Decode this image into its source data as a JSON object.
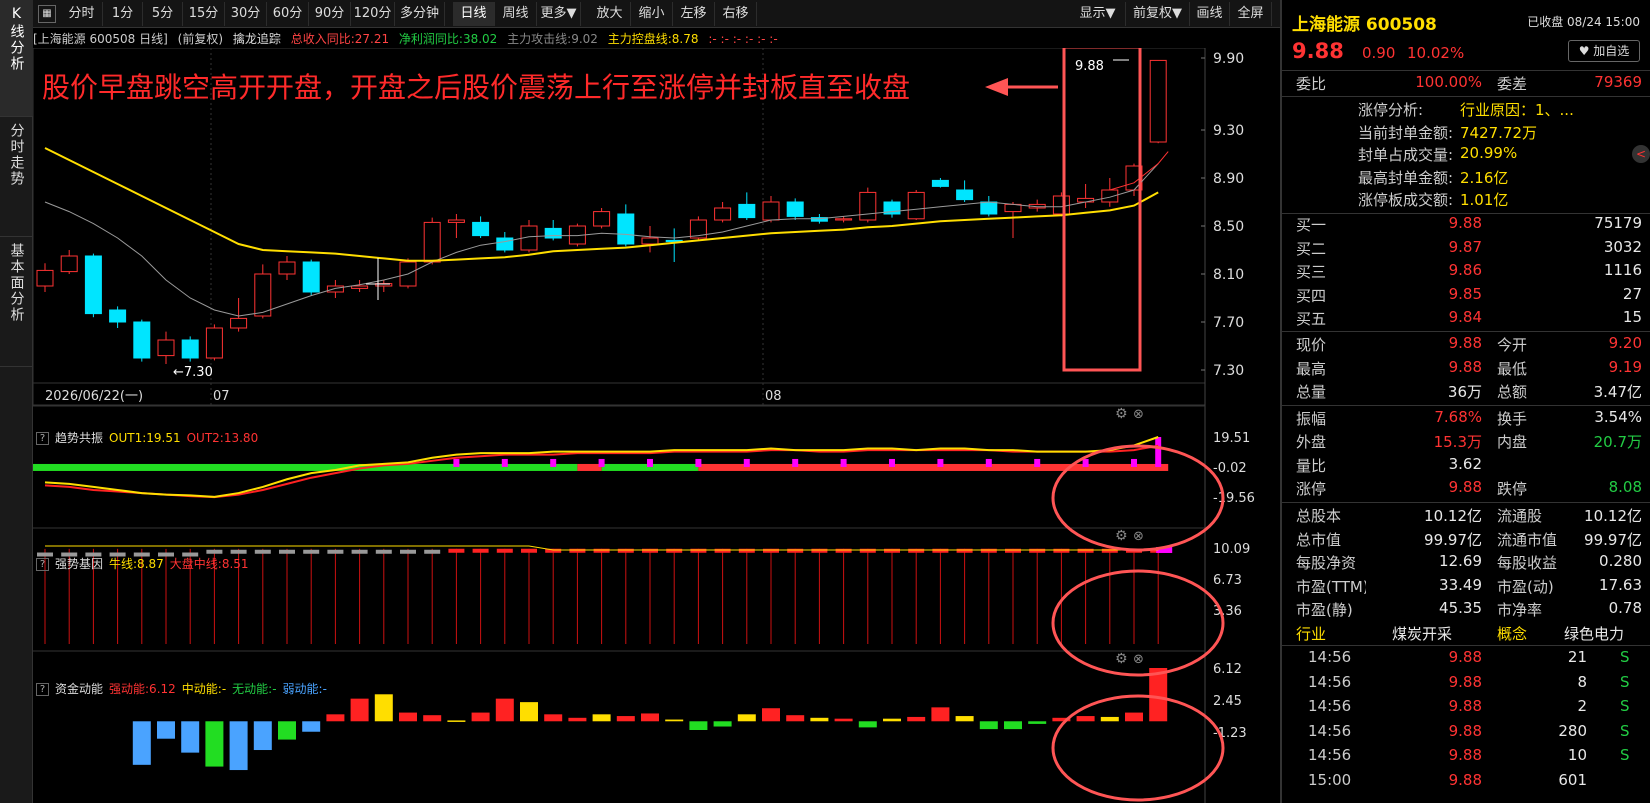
{
  "left_nav": [
    {
      "label": "K线分析"
    },
    {
      "label": "分时走势"
    },
    {
      "label": "基本面分析"
    }
  ],
  "toolbar": {
    "icon": "grid-icon",
    "items": [
      "分时",
      "1分",
      "5分",
      "15分",
      "30分",
      "60分",
      "90分",
      "120分",
      "多分钟",
      "日线",
      "周线",
      "更多▼",
      "放大",
      "缩小",
      "左移",
      "右移"
    ],
    "active": "日线",
    "right_items": [
      "显示▼",
      "前复权▼",
      "画线",
      "全屏"
    ]
  },
  "chart_header": {
    "stock": "[上海能源 600508 日线]",
    "adj": "(前复权)",
    "indicator": "擒龙追踪",
    "v1": "总收入同比:27.21",
    "v2": "净利润同比:38.02",
    "v3": "主力攻击线:9.02",
    "v4": "主力控盘线:8.78",
    "v5": ":- :- :- :- :- :-"
  },
  "annotation": "股价早盘跳空高开开盘，开盘之后股价震荡上行至涨停并封板直至收盘",
  "price_axis": [
    "9.90",
    "9.30",
    "8.90",
    "8.50",
    "8.10",
    "7.70",
    "7.30"
  ],
  "date_labels": [
    "2026/06/22(一)",
    "07",
    "08"
  ],
  "low_label": "7.30",
  "high_label": "9.88",
  "panels": {
    "p1": {
      "name": "趋势共振",
      "l1": "OUT1:19.51",
      "l2": "OUT2:13.80",
      "axis": [
        "19.51",
        "-0.02",
        "-19.56"
      ]
    },
    "p2": {
      "name": "强势基因",
      "l1": "牛线:8.87",
      "l2": "大盘中线:8.51",
      "axis": [
        "10.09",
        "6.73",
        "3.36"
      ]
    },
    "p3": {
      "name": "资金动能",
      "l1": "强动能:6.12",
      "l2": "中动能:-",
      "l3": "无动能:-",
      "l4": "弱动能:-",
      "axis": [
        "6.12",
        "2.45",
        "-1.23"
      ]
    }
  },
  "colors": {
    "up": "#ff3333",
    "down": "#00e5ff",
    "ma_yellow": "#ffde00",
    "ma_gray": "#9a9a9a",
    "annot": "#ff5555"
  },
  "right_panel": {
    "name": "上海能源",
    "code": "600508",
    "status": "已收盘 08/24 15:00",
    "price": "9.88",
    "change": "0.90",
    "pct": "10.02%",
    "watch_btn": "♥ 加自选",
    "weibi_label": "委比",
    "weibi": "100.00%",
    "weicha_label": "委差",
    "weicha": "79369",
    "limit_info": [
      {
        "k": "涨停分析:",
        "v": "行业原因：1、..."
      },
      {
        "k": "当前封单金额:",
        "v": "7427.72万"
      },
      {
        "k": "封单占成交量:",
        "v": "20.99%"
      },
      {
        "k": "最高封单金额:",
        "v": "2.16亿"
      },
      {
        "k": "涨停板成交额:",
        "v": "1.01亿"
      }
    ],
    "bids": [
      {
        "k": "买一",
        "p": "9.88",
        "v": "75179"
      },
      {
        "k": "买二",
        "p": "9.87",
        "v": "3032"
      },
      {
        "k": "买三",
        "p": "9.86",
        "v": "1116"
      },
      {
        "k": "买四",
        "p": "9.85",
        "v": "27"
      },
      {
        "k": "买五",
        "p": "9.84",
        "v": "15"
      }
    ],
    "quote": [
      {
        "k1": "现价",
        "v1": "9.88",
        "c1": "red",
        "k2": "今开",
        "v2": "9.20",
        "c2": "red"
      },
      {
        "k1": "最高",
        "v1": "9.88",
        "c1": "red",
        "k2": "最低",
        "v2": "9.19",
        "c2": "red"
      },
      {
        "k1": "总量",
        "v1": "36万",
        "c1": "wht",
        "k2": "总额",
        "v2": "3.47亿",
        "c2": "wht"
      },
      {
        "k1": "振幅",
        "v1": "7.68%",
        "c1": "red",
        "k2": "换手",
        "v2": "3.54%",
        "c2": "wht"
      },
      {
        "k1": "外盘",
        "v1": "15.3万",
        "c1": "red",
        "k2": "内盘",
        "v2": "20.7万",
        "c2": "green"
      },
      {
        "k1": "量比",
        "v1": "3.62",
        "c1": "wht",
        "k2": "",
        "v2": "",
        "c2": "wht"
      },
      {
        "k1": "涨停",
        "v1": "9.88",
        "c1": "red",
        "k2": "跌停",
        "v2": "8.08",
        "c2": "green"
      }
    ],
    "fundamentals": [
      {
        "k1": "总股本",
        "v1": "10.12亿",
        "k2": "流通股",
        "v2": "10.12亿"
      },
      {
        "k1": "总市值",
        "v1": "99.97亿",
        "k2": "流通市值",
        "v2": "99.97亿"
      },
      {
        "k1": "每股净资",
        "v1": "12.69",
        "k2": "每股收益",
        "v2": "0.280"
      },
      {
        "k1": "市盈(TTM)",
        "v1": "33.49",
        "k2": "市盈(动)",
        "v2": "17.63"
      },
      {
        "k1": "市盈(静)",
        "v1": "45.35",
        "k2": "市净率",
        "v2": "0.78"
      }
    ],
    "industry": {
      "k1": "行业",
      "v1": "煤炭开采",
      "k2": "概念",
      "v2": "绿色电力"
    },
    "ticks": [
      {
        "t": "14:56",
        "p": "9.88",
        "v": "21",
        "s": "S"
      },
      {
        "t": "14:56",
        "p": "9.88",
        "v": "8",
        "s": "S"
      },
      {
        "t": "14:56",
        "p": "9.88",
        "v": "2",
        "s": "S"
      },
      {
        "t": "14:56",
        "p": "9.88",
        "v": "280",
        "s": "S"
      },
      {
        "t": "14:56",
        "p": "9.88",
        "v": "10",
        "s": "S"
      },
      {
        "t": "15:00",
        "p": "9.88",
        "v": "601",
        "s": ""
      }
    ]
  },
  "chart_data": {
    "type": "candlestick",
    "y_range": [
      7.3,
      9.9
    ],
    "candles": [
      [
        8.0,
        8.13,
        7.95,
        8.19
      ],
      [
        8.12,
        8.25,
        8.1,
        8.3
      ],
      [
        8.25,
        7.77,
        7.74,
        8.27
      ],
      [
        7.8,
        7.7,
        7.65,
        7.83
      ],
      [
        7.7,
        7.4,
        7.37,
        7.72
      ],
      [
        7.42,
        7.55,
        7.35,
        7.62
      ],
      [
        7.55,
        7.4,
        7.37,
        7.58
      ],
      [
        7.4,
        7.65,
        7.38,
        7.68
      ],
      [
        7.65,
        7.73,
        7.62,
        7.9
      ],
      [
        7.75,
        8.1,
        7.73,
        8.18
      ],
      [
        8.1,
        8.2,
        8.05,
        8.25
      ],
      [
        8.2,
        7.95,
        7.92,
        8.22
      ],
      [
        7.95,
        8.0,
        7.9,
        8.05
      ],
      [
        7.98,
        8.0,
        7.95,
        8.05
      ],
      [
        8.0,
        8.02,
        7.95,
        8.05
      ],
      [
        8.0,
        8.2,
        7.98,
        8.23
      ],
      [
        8.2,
        8.53,
        8.18,
        8.57
      ],
      [
        8.53,
        8.55,
        8.4,
        8.6
      ],
      [
        8.53,
        8.42,
        8.4,
        8.58
      ],
      [
        8.4,
        8.3,
        8.28,
        8.45
      ],
      [
        8.3,
        8.5,
        8.28,
        8.55
      ],
      [
        8.48,
        8.4,
        8.38,
        8.55
      ],
      [
        8.35,
        8.5,
        8.33,
        8.52
      ],
      [
        8.5,
        8.62,
        8.48,
        8.65
      ],
      [
        8.6,
        8.35,
        8.33,
        8.68
      ],
      [
        8.35,
        8.4,
        8.28,
        8.5
      ],
      [
        8.38,
        8.37,
        8.2,
        8.48
      ],
      [
        8.4,
        8.55,
        8.38,
        8.58
      ],
      [
        8.55,
        8.65,
        8.53,
        8.7
      ],
      [
        8.68,
        8.57,
        8.55,
        8.78
      ],
      [
        8.55,
        8.7,
        8.53,
        8.75
      ],
      [
        8.7,
        8.58,
        8.55,
        8.73
      ],
      [
        8.57,
        8.54,
        8.52,
        8.6
      ],
      [
        8.55,
        8.56,
        8.53,
        8.58
      ],
      [
        8.55,
        8.78,
        8.53,
        8.82
      ],
      [
        8.7,
        8.6,
        8.57,
        8.72
      ],
      [
        8.56,
        8.78,
        8.55,
        8.8
      ],
      [
        8.88,
        8.83,
        8.82,
        8.9
      ],
      [
        8.8,
        8.72,
        8.7,
        8.88
      ],
      [
        8.7,
        8.6,
        8.58,
        8.75
      ],
      [
        8.62,
        8.68,
        8.4,
        8.7
      ],
      [
        8.65,
        8.68,
        8.62,
        8.72
      ],
      [
        8.6,
        8.75,
        8.58,
        8.78
      ],
      [
        8.7,
        8.73,
        8.65,
        8.85
      ],
      [
        8.7,
        8.8,
        8.66,
        8.9
      ],
      [
        8.8,
        9.0,
        8.75,
        9.02
      ],
      [
        9.2,
        9.88,
        9.19,
        9.88
      ]
    ],
    "ma_yellow": [
      9.15,
      9.05,
      8.95,
      8.85,
      8.75,
      8.65,
      8.55,
      8.45,
      8.35,
      8.3,
      8.29,
      8.28,
      8.27,
      8.25,
      8.23,
      8.21,
      8.21,
      8.22,
      8.23,
      8.24,
      8.26,
      8.29,
      8.3,
      8.31,
      8.32,
      8.34,
      8.36,
      8.38,
      8.4,
      8.42,
      8.44,
      8.45,
      8.46,
      8.47,
      8.49,
      8.5,
      8.52,
      8.54,
      8.55,
      8.56,
      8.57,
      8.58,
      8.59,
      8.61,
      8.63,
      8.67,
      8.78
    ],
    "ma_gray": [
      8.7,
      8.62,
      8.52,
      8.4,
      8.25,
      8.05,
      7.9,
      7.8,
      7.75,
      7.78,
      7.85,
      7.92,
      7.98,
      8.01,
      8.05,
      8.1,
      8.2,
      8.28,
      8.34,
      8.37,
      8.41,
      8.42,
      8.42,
      8.44,
      8.43,
      8.41,
      8.4,
      8.42,
      8.45,
      8.5,
      8.55,
      8.56,
      8.56,
      8.58,
      8.6,
      8.62,
      8.64,
      8.66,
      8.68,
      8.7,
      8.68,
      8.66,
      8.66,
      8.7,
      8.74,
      8.8,
      9.02
    ],
    "p1_out1": [
      -10,
      -11,
      -13,
      -15,
      -17,
      -18,
      -18.5,
      -19.5,
      -17,
      -13,
      -8,
      -4,
      -2,
      1,
      2,
      3,
      6,
      8,
      9,
      9,
      9,
      10,
      10,
      10,
      10,
      10,
      11,
      11,
      11,
      11,
      12,
      11,
      11,
      11,
      12,
      12,
      11,
      12,
      12,
      11,
      11,
      10,
      10,
      10,
      11,
      14,
      19.51
    ],
    "p1_out2": [
      -12,
      -13,
      -15,
      -16,
      -17,
      -18,
      -19,
      -19.6,
      -18,
      -15,
      -11,
      -7,
      -4,
      -1,
      1,
      2,
      4,
      6,
      7,
      8,
      8,
      8,
      9,
      9,
      9,
      9,
      10,
      10,
      10,
      10,
      11,
      11,
      10,
      10,
      11,
      11,
      11,
      11,
      11,
      11,
      10,
      10,
      10,
      10,
      10,
      11,
      13.8
    ],
    "p3_energy": [
      -5,
      -2,
      -3.6,
      -5.2,
      -5.6,
      -3.3,
      -2.1,
      -1.2,
      0.8,
      2.6,
      3.1,
      1.0,
      0.7,
      0.1,
      1.0,
      2.6,
      2.2,
      0.8,
      0.4,
      0.8,
      0.6,
      0.9,
      0.2,
      -1.0,
      -0.6,
      0.8,
      1.5,
      0.7,
      0.4,
      0.3,
      -0.7,
      0.3,
      0.5,
      1.6,
      0.6,
      -0.9,
      -0.9,
      -0.3,
      0.4,
      0.6,
      0.5,
      1.0,
      6.12
    ]
  }
}
